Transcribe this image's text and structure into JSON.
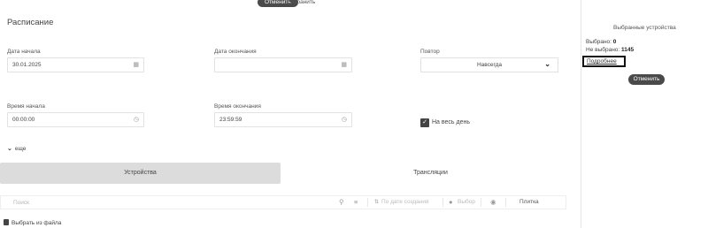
{
  "top_bar": {
    "cancel_label": "Отменить",
    "save_label": "Сохранить"
  },
  "schedule": {
    "title": "Расписание",
    "start_date": {
      "label": "Дата начала",
      "value": "30.01.2025",
      "icon": "calendar-icon"
    },
    "end_date": {
      "label": "Дата окончания",
      "value": "",
      "icon": "calendar-icon"
    },
    "repeat": {
      "label": "Повтор",
      "value": "Навсегда",
      "icon": "chevron-down-icon"
    },
    "start_time": {
      "label": "Время начала",
      "value": "00:00:00",
      "icon": "clock-icon"
    },
    "end_time": {
      "label": "Время окончания",
      "value": "23:59:59",
      "icon": "clock-icon"
    },
    "all_day": {
      "label": "На весь день",
      "checked": true
    },
    "more_label": "еще"
  },
  "tabs": [
    {
      "label": "Устройства",
      "active": true
    },
    {
      "label": "Трансляции",
      "active": false
    }
  ],
  "toolbar": {
    "search_placeholder": "Поиск",
    "sort_label": "По дате создания",
    "selection_label": "Выбор",
    "view_label": "Плитка"
  },
  "file_pick_label": "Выбрать из файла",
  "side_panel": {
    "title": "Выбранные устройства",
    "selected_label": "Выбрано:",
    "selected_count": "0",
    "not_selected_label": "Не выбрано:",
    "not_selected_count": "1145",
    "details_label": "Подробнее",
    "cancel_label": "Отменить"
  }
}
